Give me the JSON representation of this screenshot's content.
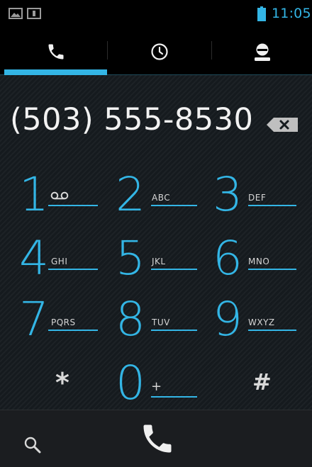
{
  "status_bar": {
    "time": "11:05",
    "icons": [
      "image-notification-icon",
      "sd-card-icon",
      "battery-icon"
    ],
    "accent_color": "#33b5e5"
  },
  "tabs": [
    {
      "name": "phone",
      "icon": "phone-icon",
      "selected": true
    },
    {
      "name": "recent",
      "icon": "clock-icon",
      "selected": false
    },
    {
      "name": "contacts",
      "icon": "person-icon",
      "selected": false
    }
  ],
  "dialer": {
    "number": "(503) 555-8530",
    "delete_icon": "backspace-icon"
  },
  "keypad": {
    "k1": {
      "digit": "1",
      "letters": ""
    },
    "k2": {
      "digit": "2",
      "letters": "ABC"
    },
    "k3": {
      "digit": "3",
      "letters": "DEF"
    },
    "k4": {
      "digit": "4",
      "letters": "GHI"
    },
    "k5": {
      "digit": "5",
      "letters": "JKL"
    },
    "k6": {
      "digit": "6",
      "letters": "MNO"
    },
    "k7": {
      "digit": "7",
      "letters": "PQRS"
    },
    "k8": {
      "digit": "8",
      "letters": "TUV"
    },
    "k9": {
      "digit": "9",
      "letters": "WXYZ"
    },
    "kstar": {
      "digit": "*"
    },
    "k0": {
      "digit": "0",
      "letters": "+"
    },
    "khash": {
      "digit": "#"
    }
  },
  "action_bar": {
    "search_icon": "search-icon",
    "dial_icon": "phone-icon"
  }
}
